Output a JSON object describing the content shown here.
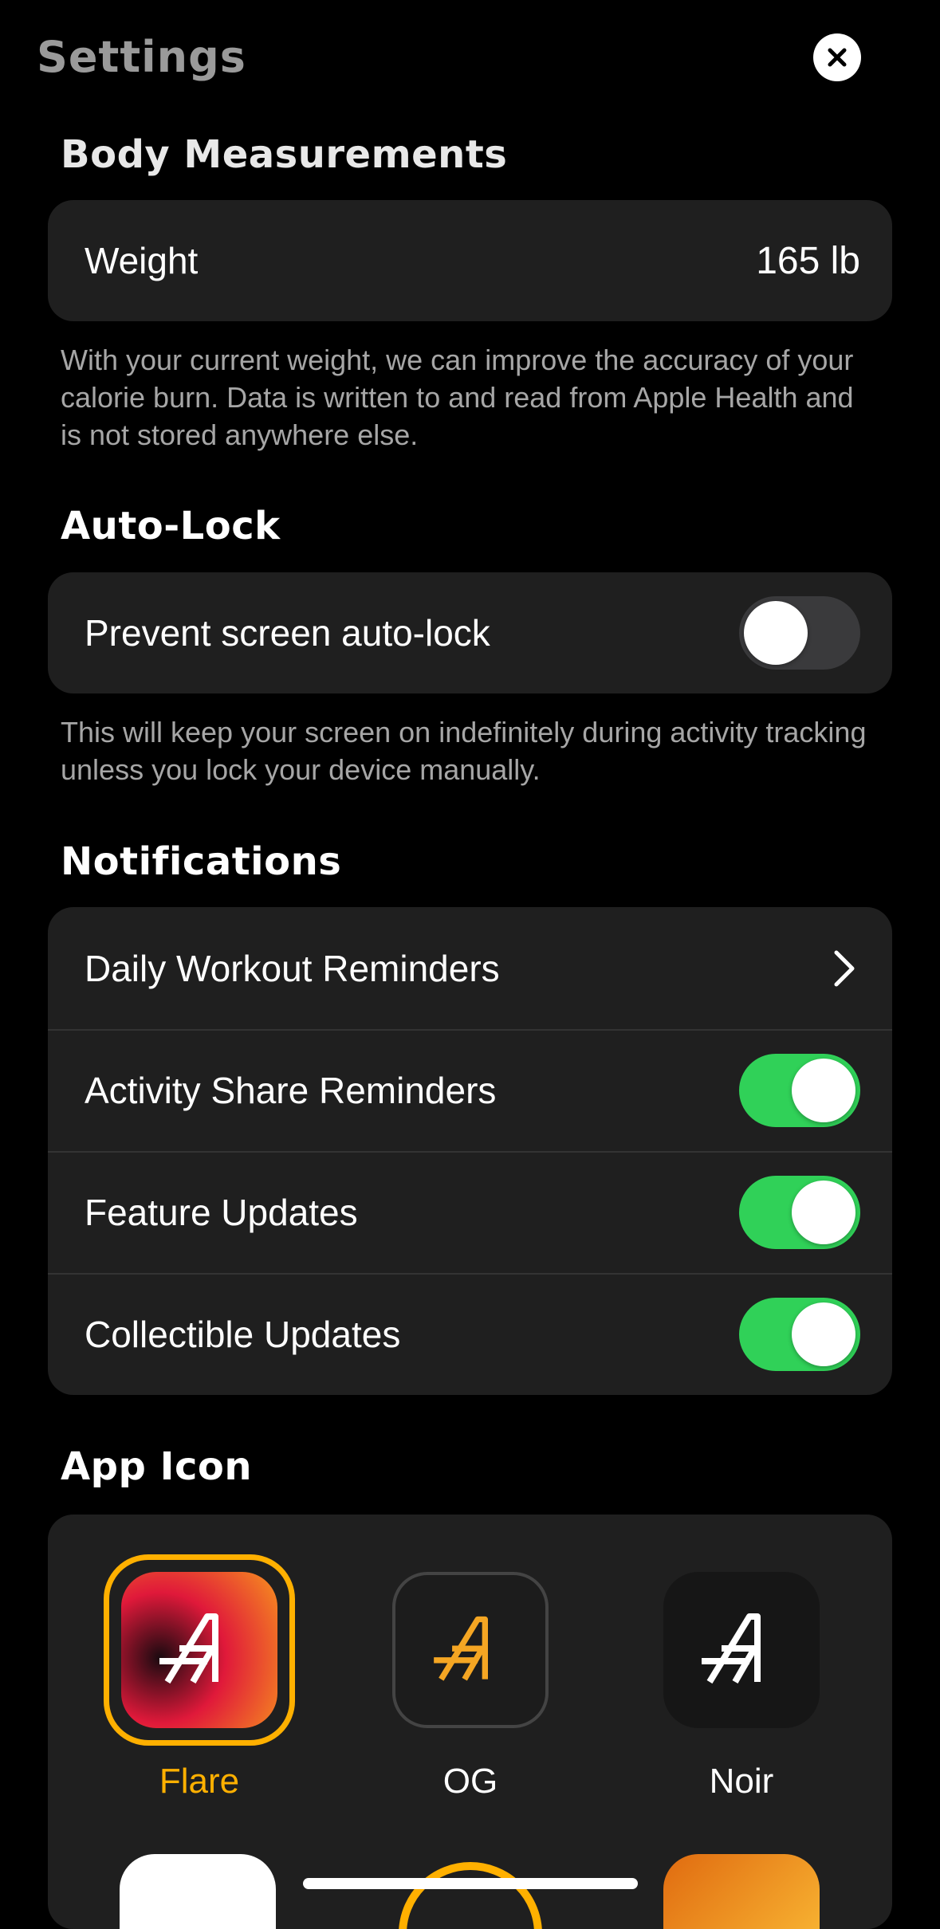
{
  "header": {
    "title": "Settings"
  },
  "body_measurements": {
    "title": "Body Measurements",
    "weight_label": "Weight",
    "weight_value": "165 lb",
    "note": "With your current weight, we can improve the accuracy of your calorie burn. Data is written to and read from Apple Health and is not stored anywhere else."
  },
  "auto_lock": {
    "title": "Auto-Lock",
    "label": "Prevent screen auto-lock",
    "enabled": false,
    "note": "This will keep your screen on indefinitely during activity tracking unless you lock your device manually."
  },
  "notifications": {
    "title": "Notifications",
    "items": [
      {
        "label": "Daily Workout Reminders",
        "control": "chevron"
      },
      {
        "label": "Activity Share Reminders",
        "control": "toggle",
        "enabled": true
      },
      {
        "label": "Feature Updates",
        "control": "toggle",
        "enabled": true
      },
      {
        "label": "Collectible Updates",
        "control": "toggle",
        "enabled": true
      }
    ]
  },
  "app_icon": {
    "title": "App Icon",
    "icons": [
      {
        "label": "Flare",
        "selected": true
      },
      {
        "label": "OG",
        "selected": false
      },
      {
        "label": "Noir",
        "selected": false
      }
    ]
  },
  "colors": {
    "accent": "#ffb000",
    "toggle_on": "#30d158",
    "card": "#1f1f1f"
  }
}
